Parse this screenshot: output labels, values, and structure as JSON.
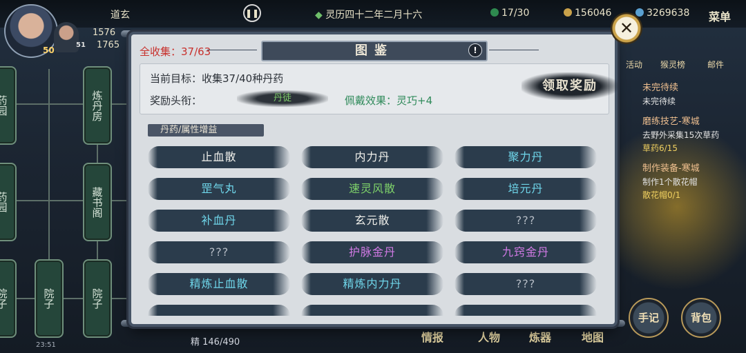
{
  "header": {
    "location": "道玄",
    "date": "灵历四十二年二月十六",
    "energy": "17/30",
    "coins": "156046",
    "currency2": "3269638",
    "menu_label": "菜单",
    "hp_value": "1576",
    "mp_value": "1765",
    "level_main": "50",
    "level_companion": "51"
  },
  "map": {
    "nodes": [
      "炼丹房",
      "藏书阁",
      "院子",
      "院子",
      "药园",
      "药园",
      "院子"
    ]
  },
  "modal": {
    "collect_label": "全收集：37/63",
    "title": "图鉴",
    "info_icon": "!",
    "goal_text": "当前目标：收集37/40种丹药",
    "reward_label": "奖励头衔：",
    "reward_title": "丹徒",
    "effect_text": "佩戴效果：灵巧+4",
    "claim_label": "领取奖励",
    "category_tab": "丹药/属性增益",
    "items": [
      {
        "name": "止血散",
        "color": "#f1f1ec"
      },
      {
        "name": "内力丹",
        "color": "#f1f1ec"
      },
      {
        "name": "聚力丹",
        "color": "#6fd6ea"
      },
      {
        "name": "罡气丸",
        "color": "#6fd6ea"
      },
      {
        "name": "速灵风散",
        "color": "#7fd36a"
      },
      {
        "name": "培元丹",
        "color": "#6fd6ea"
      },
      {
        "name": "补血丹",
        "color": "#6fd6ea"
      },
      {
        "name": "玄元散",
        "color": "#f1f1ec"
      },
      {
        "name": "???",
        "color": "#b5bcc5"
      },
      {
        "name": "???",
        "color": "#b5bcc5"
      },
      {
        "name": "护脉金丹",
        "color": "#d27ae6"
      },
      {
        "name": "九窍金丹",
        "color": "#d27ae6"
      },
      {
        "name": "精炼止血散",
        "color": "#6fd6ea"
      },
      {
        "name": "精炼内力丹",
        "color": "#6fd6ea"
      },
      {
        "name": "???",
        "color": "#b5bcc5"
      }
    ]
  },
  "top_icons": [
    "活动",
    "猴灵榜",
    "邮件"
  ],
  "quests": [
    {
      "title": "未完待续",
      "text": "未完待续",
      "progress": ""
    },
    {
      "title": "磨练技艺-寒城",
      "text": "去野外采集15次草药",
      "progress": "草药6/15"
    },
    {
      "title": "制作装备-寒城",
      "text": "制作1个散花帽",
      "progress": "散花帽0/1"
    }
  ],
  "bottom": {
    "menu": [
      "情报",
      "人物",
      "炼器",
      "地图"
    ],
    "round_buttons": [
      "手记",
      "背包"
    ],
    "stamina": "精 146/490",
    "clock": "23:51"
  }
}
